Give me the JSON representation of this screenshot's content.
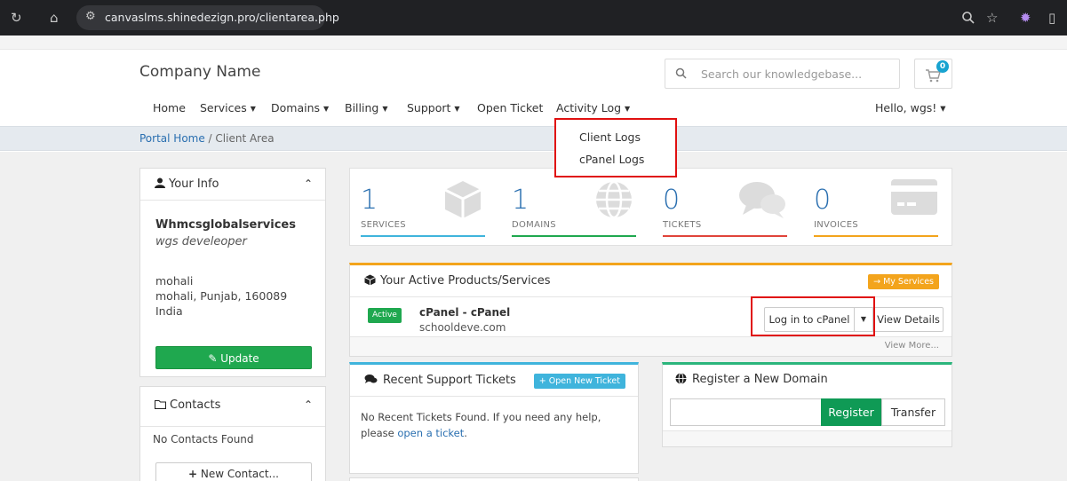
{
  "browser": {
    "url": "canvaslms.shinedezign.pro/clientarea.php"
  },
  "header": {
    "company": "Company Name",
    "search_placeholder": "Search our knowledgebase...",
    "cart_count": "0",
    "greeting": "Hello, wgs! ▾"
  },
  "nav": {
    "home": "Home",
    "services": "Services",
    "domains": "Domains",
    "billing": "Billing",
    "support": "Support",
    "open_ticket": "Open Ticket",
    "activity_log": "Activity Log"
  },
  "activity_dropdown": {
    "client_logs": "Client Logs",
    "cpanel_logs": "cPanel Logs"
  },
  "breadcrumb": {
    "home": "Portal Home",
    "separator": " / ",
    "current": "Client Area"
  },
  "your_info": {
    "title": "Your Info",
    "name": "Whmcsglobalservices",
    "role": "wgs develeoper",
    "city": "mohali",
    "address": "mohali, Punjab, 160089",
    "country": "India",
    "update_label": "Update"
  },
  "contacts": {
    "title": "Contacts",
    "empty": "No Contacts Found",
    "new_label": "New Contact..."
  },
  "stats": [
    {
      "count": "1",
      "label": "SERVICES",
      "color": "#3fb4dc"
    },
    {
      "count": "1",
      "label": "DOMAINS",
      "color": "#1fa84f"
    },
    {
      "count": "0",
      "label": "TICKETS",
      "color": "#e0443a"
    },
    {
      "count": "0",
      "label": "INVOICES",
      "color": "#f3a41c"
    }
  ],
  "products": {
    "title": "Your Active Products/Services",
    "my_services": "→ My Services",
    "status": "Active",
    "name": "cPanel - cPanel",
    "domain": "schooldeve.com",
    "login_label": "Log in to cPanel",
    "details_label": "View Details",
    "view_more": "View More..."
  },
  "tickets": {
    "title": "Recent Support Tickets",
    "open_new": "+ Open New Ticket",
    "message": "No Recent Tickets Found. If you need any help, please",
    "link": "open a ticket",
    "period": "."
  },
  "register": {
    "title": "Register a New Domain",
    "register_label": "Register",
    "transfer_label": "Transfer"
  },
  "colors": {
    "accent_blue": "#2a6fb0",
    "green": "#1fa84f",
    "orange": "#f3a41c",
    "highlight_red": "#e01010"
  }
}
